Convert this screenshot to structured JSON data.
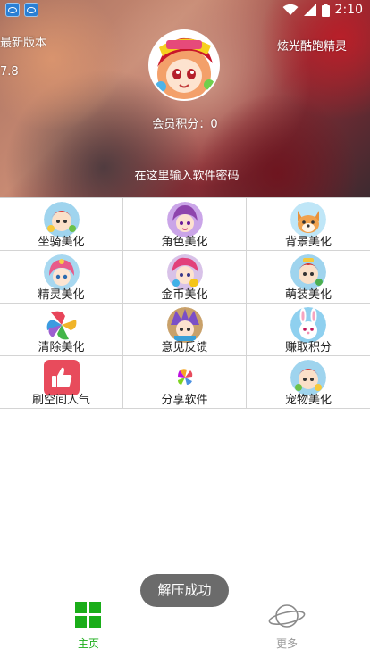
{
  "status_bar": {
    "time": "2:10",
    "icons": [
      "app-icon",
      "app-icon",
      "wifi-icon",
      "signal-icon",
      "battery-icon"
    ]
  },
  "header": {
    "version_label": "最新版本",
    "version_number": "7.8",
    "app_name": "炫光酷跑精灵",
    "points_label": "会员积分：0",
    "password_placeholder": "在这里输入软件密码"
  },
  "grid": {
    "items": [
      {
        "label": "坐骑美化",
        "icon": "mount-avatar-icon"
      },
      {
        "label": "角色美化",
        "icon": "character-avatar-icon"
      },
      {
        "label": "背景美化",
        "icon": "background-dog-icon"
      },
      {
        "label": "精灵美化",
        "icon": "sprite-avatar-icon"
      },
      {
        "label": "金币美化",
        "icon": "coin-avatar-icon"
      },
      {
        "label": "萌装美化",
        "icon": "costume-avatar-icon"
      },
      {
        "label": "清除美化",
        "icon": "clear-pinwheel-icon"
      },
      {
        "label": "意见反馈",
        "icon": "feedback-avatar-icon"
      },
      {
        "label": "赚取积分",
        "icon": "earn-points-bunny-icon"
      },
      {
        "label": "刷空间人气",
        "icon": "thumbs-up-icon"
      },
      {
        "label": "分享软件",
        "icon": "share-flower-icon"
      },
      {
        "label": "宠物美化",
        "icon": "pet-avatar-icon"
      }
    ]
  },
  "toast": {
    "text": "解压成功"
  },
  "bottom_nav": {
    "home_label": "主页",
    "more_label": "更多"
  },
  "colors": {
    "accent": "#1aad19",
    "nav_inactive": "#999999",
    "toast_bg": "#6b6b6b",
    "grid_border": "#d4d4d4"
  }
}
